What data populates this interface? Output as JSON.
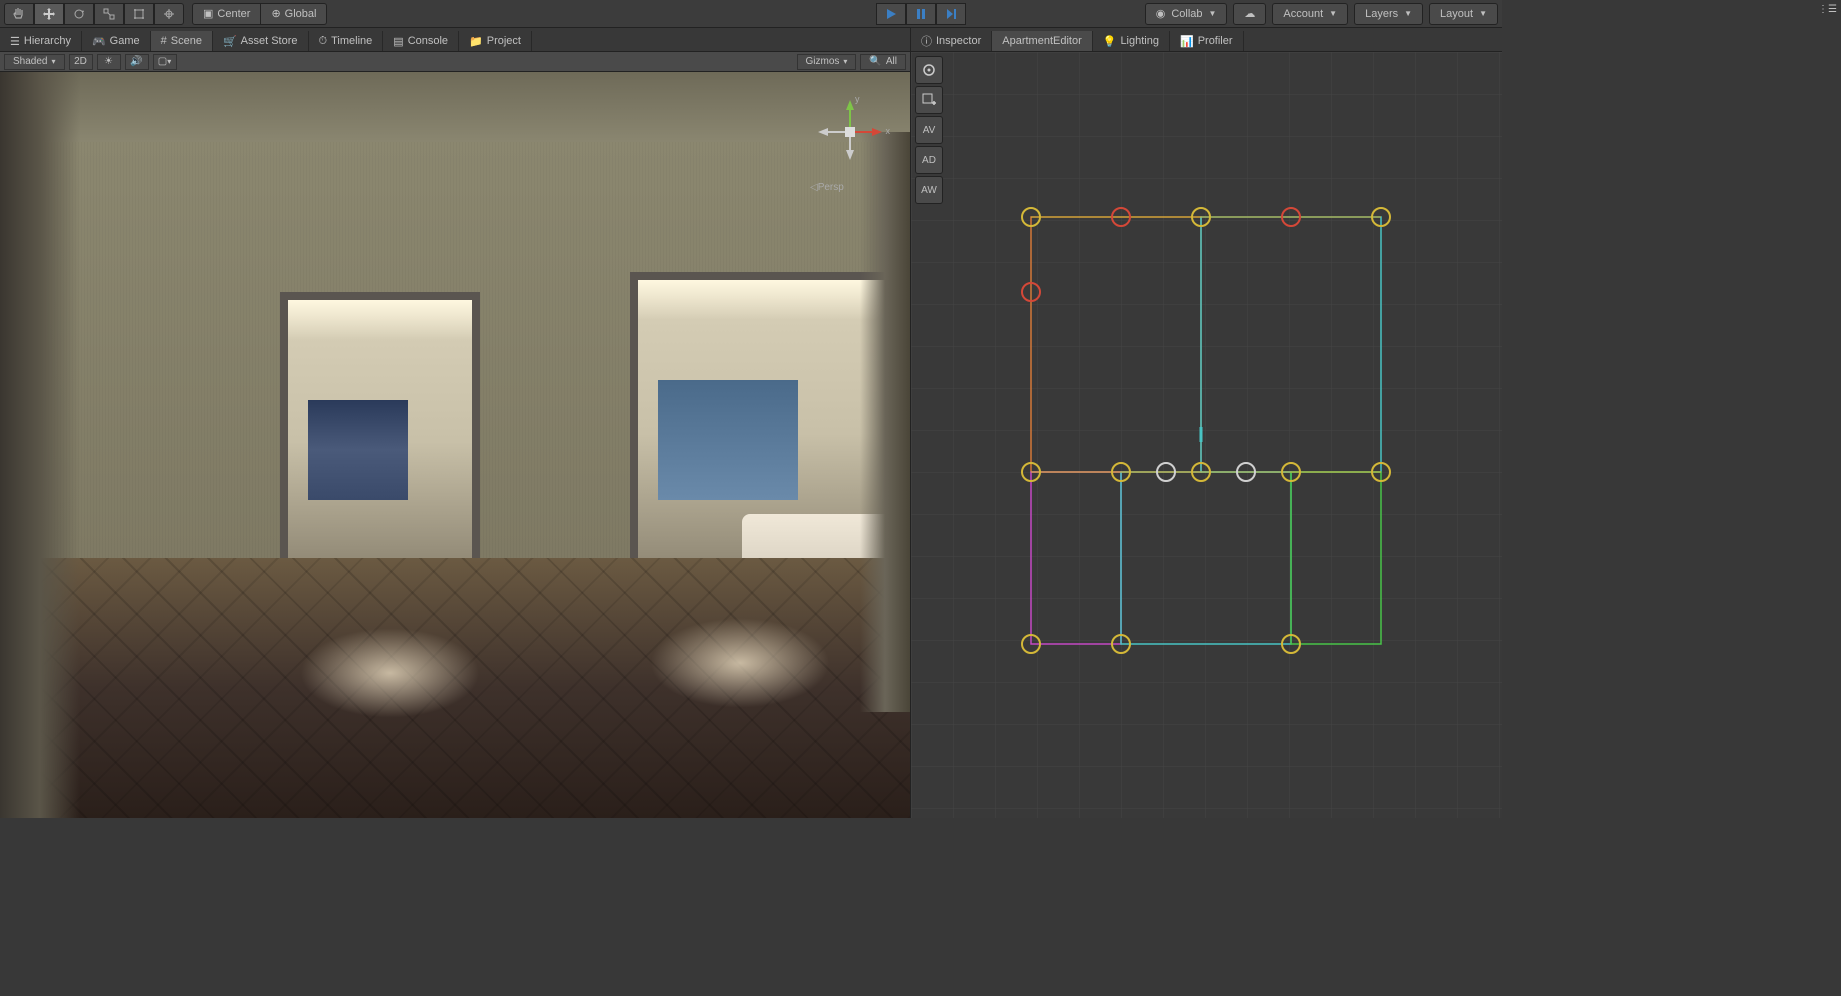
{
  "toolbar": {
    "pivot_center": "Center",
    "pivot_global": "Global",
    "collab": "Collab",
    "account": "Account",
    "layers": "Layers",
    "layout": "Layout"
  },
  "tabs_left": {
    "hierarchy": "Hierarchy",
    "game": "Game",
    "scene": "Scene",
    "asset_store": "Asset Store",
    "timeline": "Timeline",
    "console": "Console",
    "project": "Project"
  },
  "tabs_right": {
    "inspector": "Inspector",
    "apartment_editor": "ApartmentEditor",
    "lighting": "Lighting",
    "profiler": "Profiler"
  },
  "scene_toolbar": {
    "shaded": "Shaded",
    "twod": "2D",
    "gizmos": "Gizmos",
    "all": "All"
  },
  "side_tools": {
    "av": "AV",
    "ad": "AD",
    "aw": "AW"
  },
  "gizmo": {
    "x": "x",
    "y": "y",
    "persp": "Persp"
  },
  "colors": {
    "play_blue": "#3b7fc4",
    "axis_red": "#d44838",
    "axis_green": "#7ec448",
    "axis_blue": "#4878c4",
    "node_yellow": "#d4b838",
    "line_cyan": "#48c4c4",
    "line_magenta": "#c448c4",
    "line_green": "#48c448",
    "line_orange": "#d47838"
  }
}
